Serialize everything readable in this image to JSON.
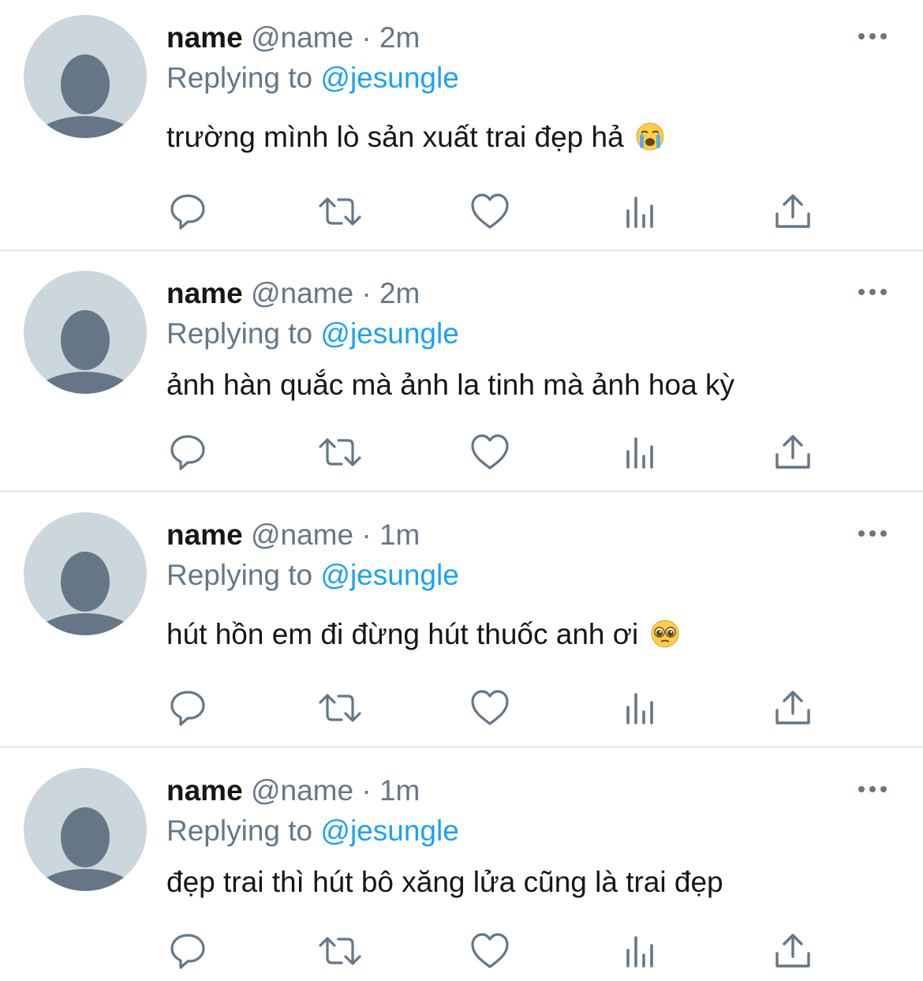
{
  "colors": {
    "name": "#14171a",
    "secondary": "#657786",
    "link": "#1da1f2",
    "avatar_bg": "#ccd6dd",
    "avatar_fg": "#657786",
    "divider": "#e6ecf0"
  },
  "tweets": [
    {
      "name": "name",
      "handle": "@name",
      "separator": "·",
      "time": "2m",
      "replying_label": "Replying to",
      "replying_handle": "@jesungle",
      "text": "trường mình lò sản xuất trai đẹp hả",
      "emoji": "loudly-crying-face"
    },
    {
      "name": "name",
      "handle": "@name",
      "separator": "·",
      "time": "2m",
      "replying_label": "Replying to",
      "replying_handle": "@jesungle",
      "text": "ảnh hàn quắc mà ảnh la tinh mà ảnh hoa kỳ",
      "emoji": ""
    },
    {
      "name": "name",
      "handle": "@name",
      "separator": "·",
      "time": "1m",
      "replying_label": "Replying to",
      "replying_handle": "@jesungle",
      "text": "hút hồn em đi đừng hút thuốc anh ơi",
      "emoji": "pleading-face"
    },
    {
      "name": "name",
      "handle": "@name",
      "separator": "·",
      "time": "1m",
      "replying_label": "Replying to",
      "replying_handle": "@jesungle",
      "text": "đẹp trai thì hút bô xăng lửa cũng là trai đẹp",
      "emoji": ""
    }
  ],
  "action_icons": [
    "reply-icon",
    "retweet-icon",
    "like-icon",
    "analytics-icon",
    "share-icon"
  ],
  "more_icon": "more-options-icon"
}
